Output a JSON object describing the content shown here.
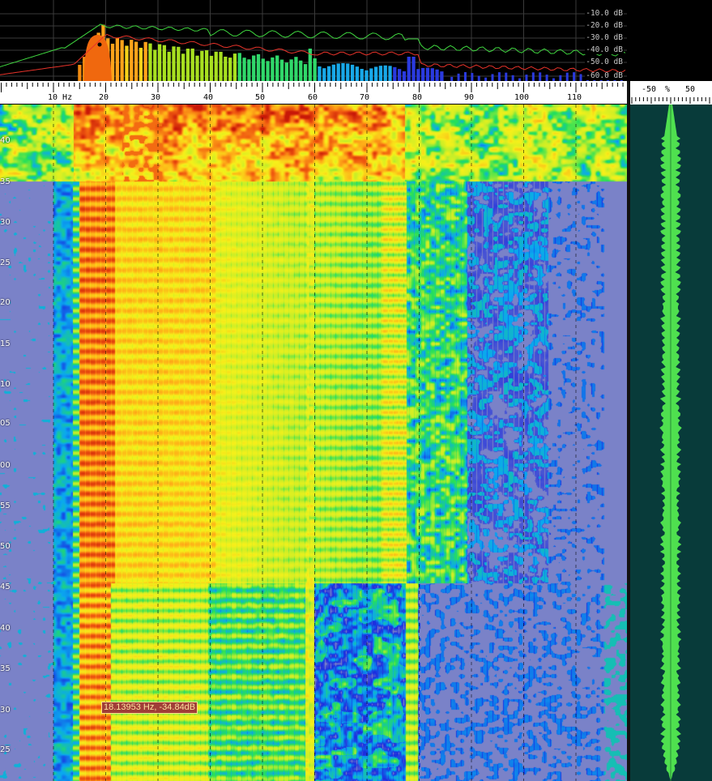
{
  "spectrum": {
    "db_scale": [
      "-10.0 dB",
      "-20.0 dB",
      "-30.0 dB",
      "-40.0 dB",
      "-50.0 dB",
      "-60.0 dB"
    ],
    "colors": {
      "peak_hold": "#3fd73f",
      "average": "#e8332a",
      "grid": "#3a3a3a"
    }
  },
  "frequency_axis": {
    "unit": "Hz",
    "labels": [
      "10 Hz",
      "20",
      "30",
      "40",
      "50",
      "60",
      "70",
      "80",
      "90",
      "100",
      "110"
    ]
  },
  "percent_axis": {
    "labels": [
      "-50",
      "%",
      "50"
    ]
  },
  "time_axis": {
    "labels": [
      "40",
      "35",
      "30",
      "25",
      "20",
      "15",
      "10",
      "05",
      "00",
      "55",
      "50",
      "45",
      "40",
      "35",
      "30",
      "25"
    ]
  },
  "cursor_readout": {
    "text": "18.13953 Hz, -34.84dB"
  },
  "colormap": [
    "#7a82c8",
    "#1a2ae0",
    "#0aa8f0",
    "#25e05a",
    "#c8ee28",
    "#f6f01a",
    "#ffb018",
    "#f05a10",
    "#c81808"
  ],
  "waveform": {
    "color": "#4fe04f",
    "background": "#083b3a"
  }
}
